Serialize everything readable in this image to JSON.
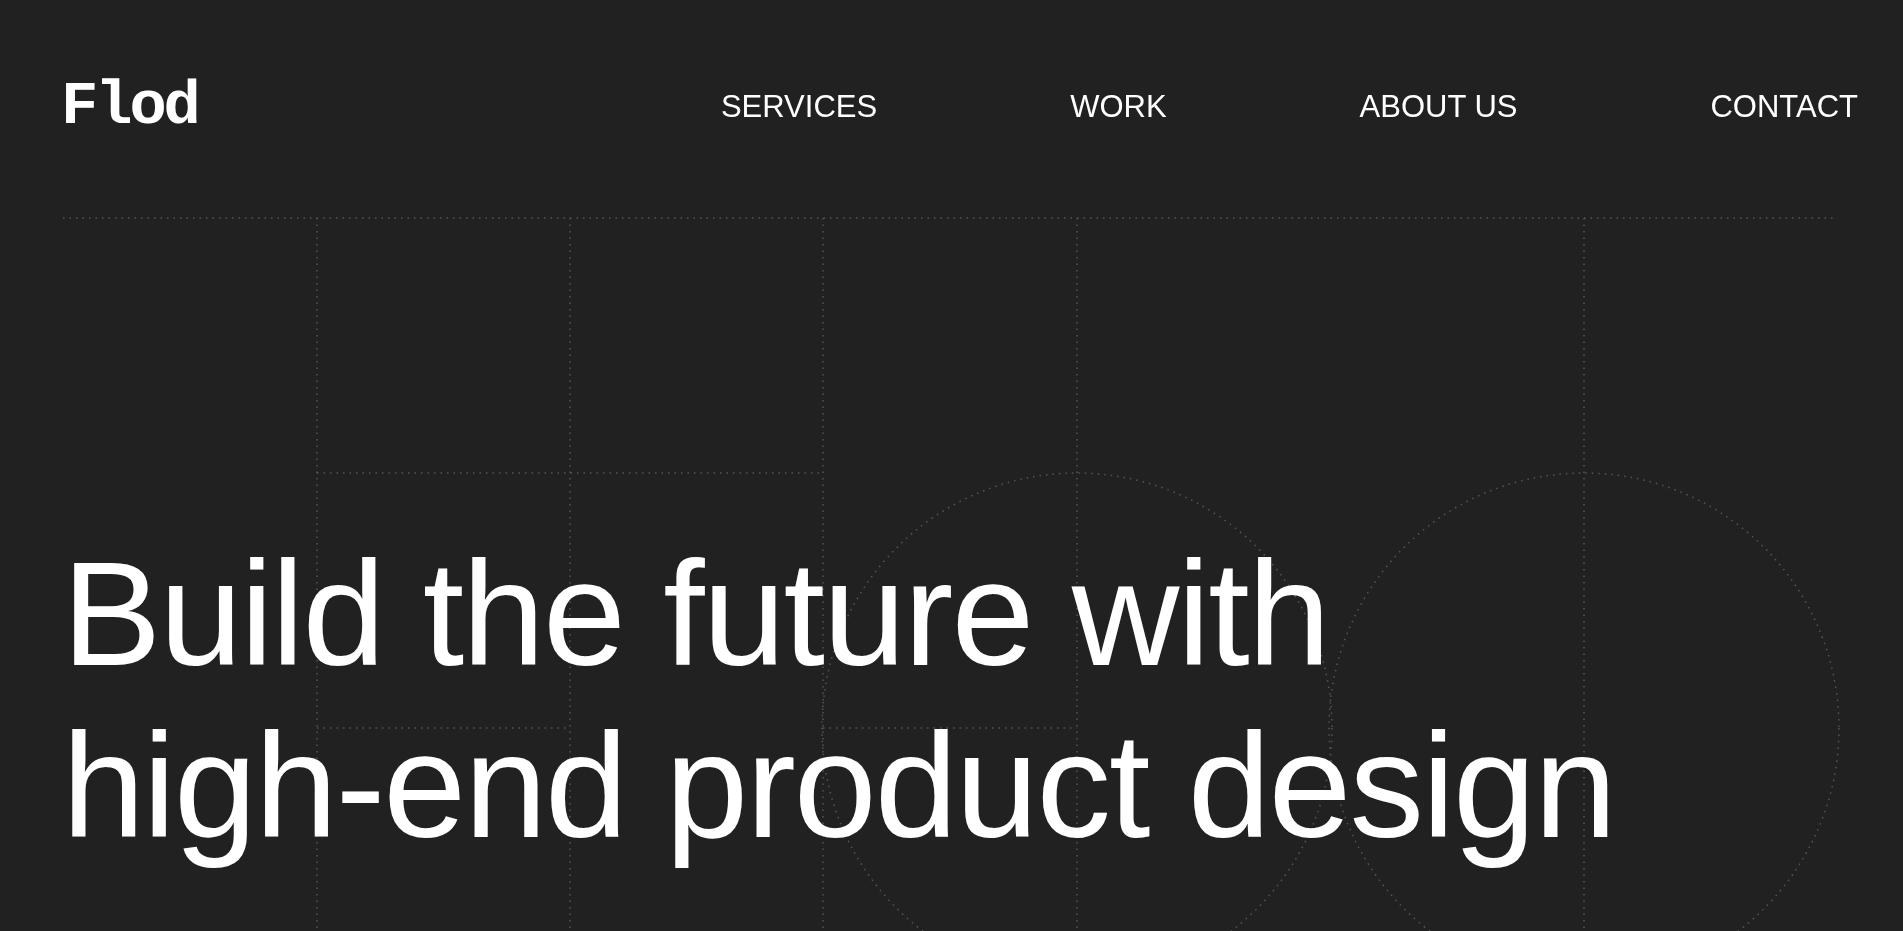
{
  "logo": "Flod",
  "nav": [
    {
      "label": "SERVICES"
    },
    {
      "label": "WORK"
    },
    {
      "label": "ABOUT US"
    },
    {
      "label": "CONTACT"
    }
  ],
  "headline": [
    "Build the future with",
    "high-end product design"
  ]
}
